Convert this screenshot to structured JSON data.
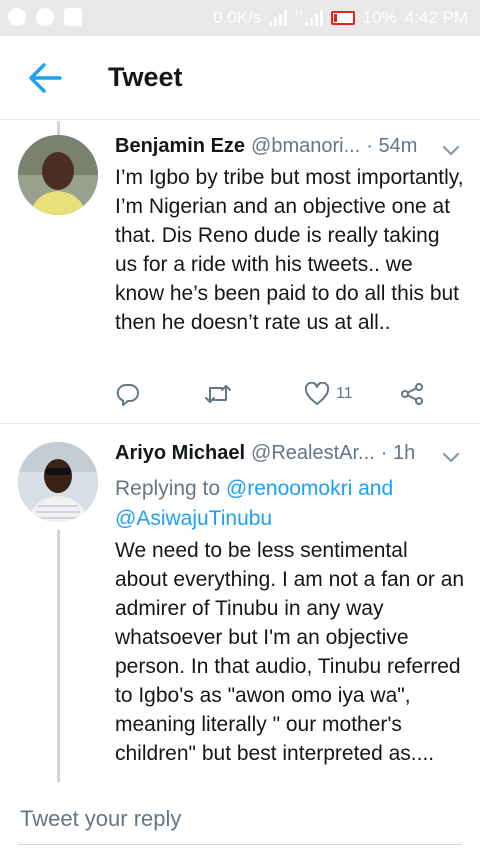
{
  "status_bar": {
    "network_speed": "0.0K/s",
    "network_type": "H",
    "battery": "10%",
    "time": "4:42 PM"
  },
  "header": {
    "title": "Tweet"
  },
  "tweets": [
    {
      "name": "Benjamin Eze",
      "handle": "@bmanori...",
      "time": "· 54m",
      "text": "I’m Igbo by tribe but most importantly, I’m Nigerian and an objective one at that. Dis Reno dude is really taking us for a ride with his tweets.. we know he’s been paid to do all this but then he doesn’t rate us at all..",
      "like_count": "11"
    },
    {
      "name": "Ariyo Michael",
      "handle": "@RealestAr...",
      "time": "· 1h",
      "replying_prefix": "Replying to",
      "replying_user1": "@renoomokri",
      "replying_and": "and",
      "replying_user2": "@AsiwajuTinubu",
      "text": "We need to be less sentimental about everything. I am not a fan or an admirer of Tinubu in any way whatsoever but I'm an objective person. In that audio, Tinubu referred to Igbo's as \"awon omo iya wa\", meaning literally \" our mother's children\" but best interpreted as...."
    }
  ],
  "compose": {
    "placeholder": "Tweet your reply"
  },
  "colors": {
    "accent": "#1da1f2",
    "secondary_text": "#657786",
    "divider": "#e6ecf0",
    "thread_line": "#ccd6dd"
  }
}
